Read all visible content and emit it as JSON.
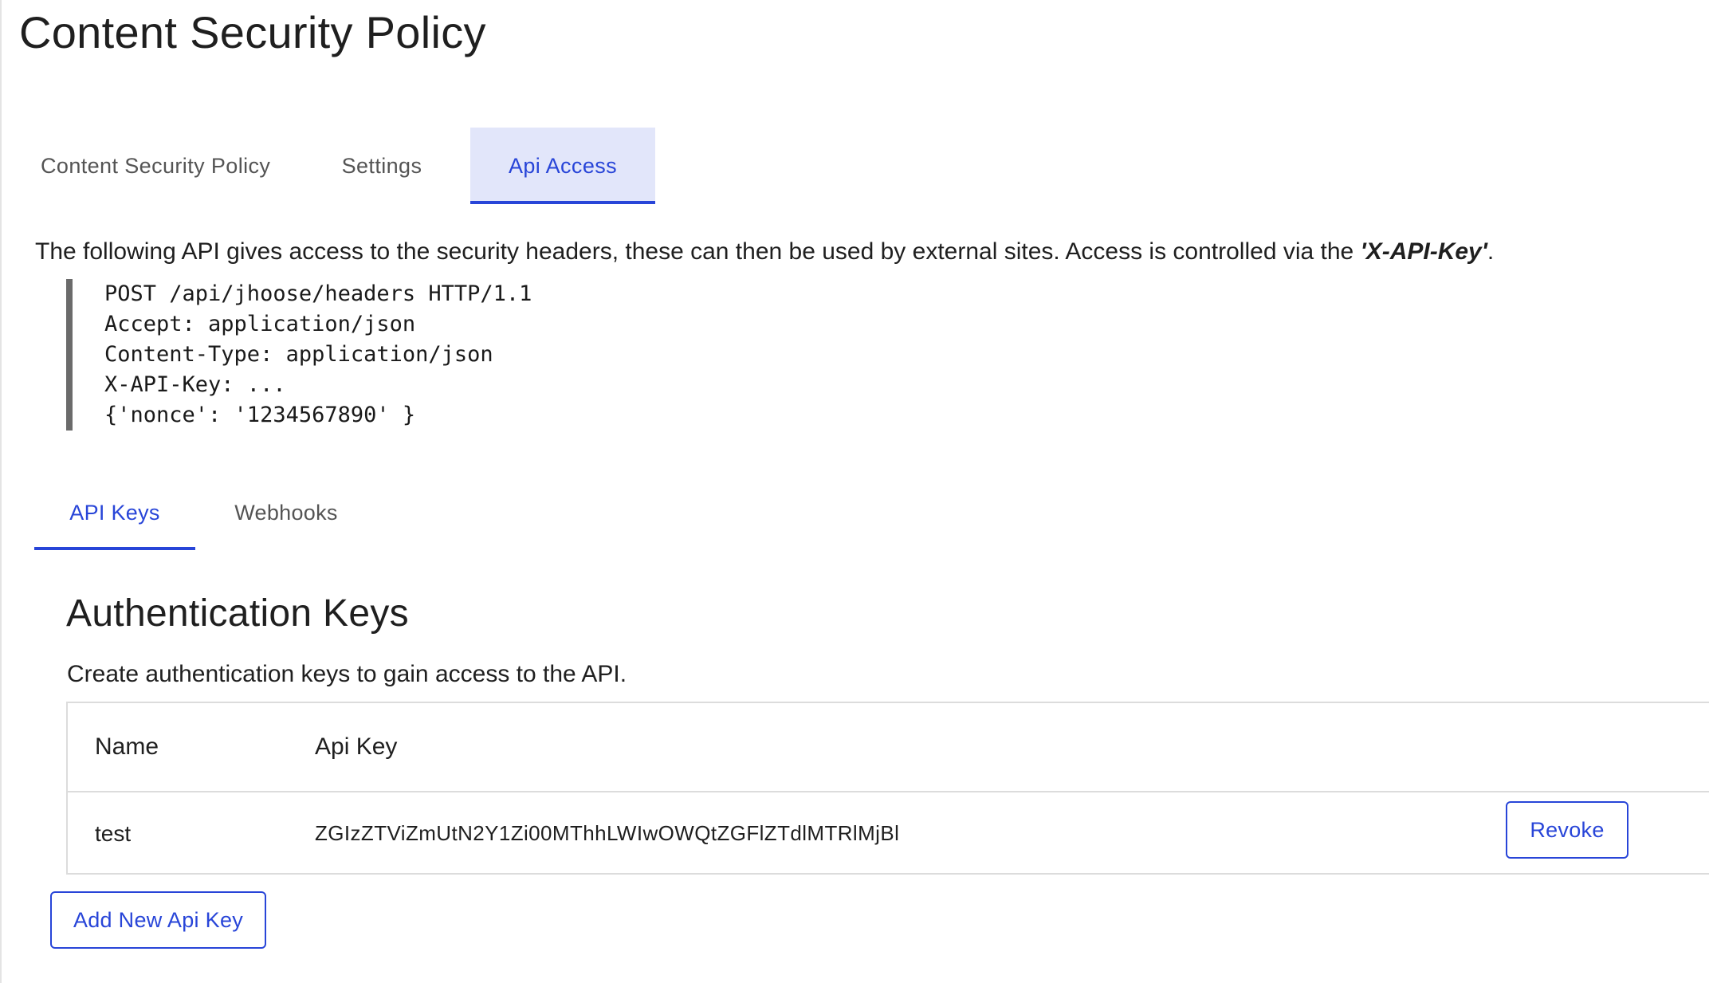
{
  "page": {
    "title": "Content Security Policy"
  },
  "tabs": {
    "items": [
      {
        "label": "Content Security Policy",
        "active": false
      },
      {
        "label": "Settings",
        "active": false
      },
      {
        "label": "Api Access",
        "active": true
      }
    ]
  },
  "api_access": {
    "intro_text": "The following API gives access to the security headers, these can then be used by external sites. Access is controlled via the ",
    "intro_key": "'X-API-Key'",
    "intro_end": ".",
    "code_lines": [
      "POST /api/jhoose/headers HTTP/1.1",
      "Accept: application/json",
      "Content-Type: application/json",
      "X-API-Key: ...",
      "{'nonce': '1234567890' }"
    ],
    "sub_tabs": [
      {
        "label": "API Keys",
        "active": true
      },
      {
        "label": "Webhooks",
        "active": false
      }
    ]
  },
  "auth_keys": {
    "title": "Authentication Keys",
    "description": "Create authentication keys to gain access to the API.",
    "columns": [
      "Name",
      "Api Key"
    ],
    "rows": [
      {
        "name": "test",
        "api_key": "ZGIzZTViZmUtN2Y1Zi00MThhLWIwOWQtZGFlZTdlMTRlMjBl",
        "action_label": "Revoke"
      }
    ],
    "add_button_label": "Add New Api Key"
  },
  "colors": {
    "accent": "#2845d8",
    "active_tab_bg": "#e2e6fa",
    "code_border": "#6b6b6b",
    "table_border": "#dcdcdc"
  }
}
